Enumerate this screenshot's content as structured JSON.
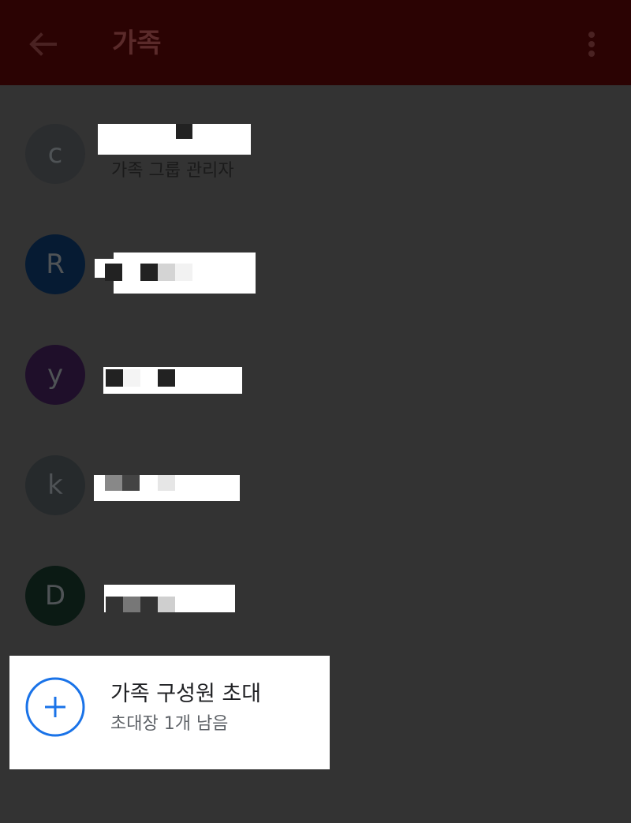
{
  "colors": {
    "appbar_bg": "#2b0303",
    "screen_bg": "#333333",
    "accent_blue": "#1a73e8"
  },
  "appbar": {
    "title": "가족",
    "back_icon": "arrow-left-icon",
    "more_icon": "more-vert-icon"
  },
  "members": [
    {
      "initial": "c",
      "name": "",
      "role": "가족 그룹 관리자",
      "avatar_color": "#2b2d2f"
    },
    {
      "initial": "R",
      "name": "",
      "role": "",
      "avatar_color": "#061b33"
    },
    {
      "initial": "y",
      "name": "",
      "role": "",
      "avatar_color": "#1f0f2a"
    },
    {
      "initial": "k",
      "name": "",
      "role": "",
      "avatar_color": "#262a2c"
    },
    {
      "initial": "D",
      "name": "",
      "role": "",
      "avatar_color": "#0b1a14"
    }
  ],
  "invite": {
    "icon": "plus-circle-icon",
    "title": "가족 구성원 초대",
    "subtitle": "초대장 1개 남음"
  }
}
